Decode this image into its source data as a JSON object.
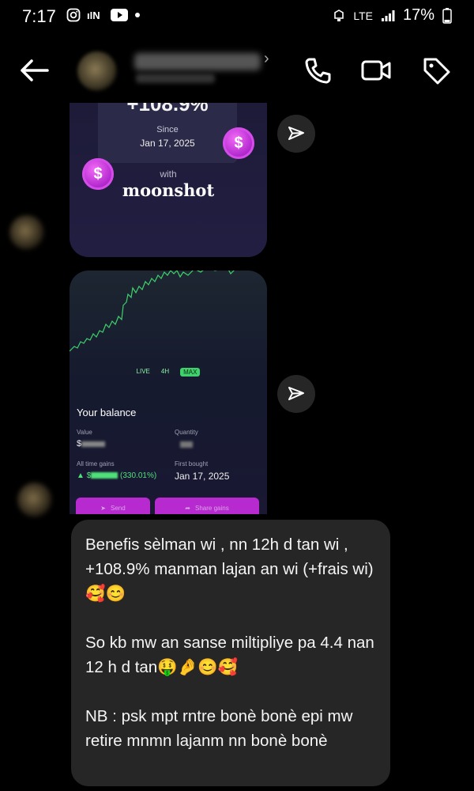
{
  "status_bar": {
    "time": "7:17",
    "network": "LTE",
    "battery": "17%"
  },
  "card_gain": {
    "percent": "+108.9%",
    "since_label": "Since",
    "since_date": "Jan 17, 2025",
    "with_label": "with",
    "brand": "moonshot",
    "coin_symbol": "$"
  },
  "card_balance": {
    "tabs": [
      "LIVE",
      "4H",
      "MAX"
    ],
    "active_tab": "MAX",
    "balance_title": "Your balance",
    "value_label": "Value",
    "value": "$",
    "quantity_label": "Quantity",
    "all_time_gains_label": "All time gains",
    "all_time_gains_pct": "(330.01%)",
    "first_bought_label": "First bought",
    "first_bought_date": "Jan 17, 2025",
    "send_label": "Send",
    "share_label": "Share gains"
  },
  "message": {
    "paragraphs": [
      "Benefis sèlman wi , nn 12h d tan wi , +108.9% manman lajan an wi (+frais wi) 🥰😊",
      "So kb mw an sanse miltipliye pa 4.4 nan 12 h d tan🤑🤌😊🥰",
      "NB : psk mpt rntre bonè bonè epi mw retire mnmn lajanm nn bonè bonè"
    ]
  },
  "colors": {
    "background": "#000000",
    "bubble": "#262626",
    "accent_green": "#4fe07a",
    "accent_purple": "#b62ad0"
  },
  "icons": [
    "back-arrow-icon",
    "phone-icon",
    "video-icon",
    "tag-icon",
    "send-share-icon"
  ]
}
